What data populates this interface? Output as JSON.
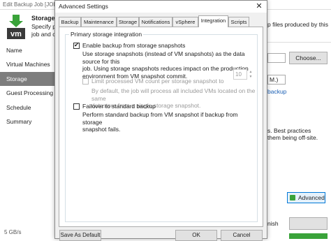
{
  "background": {
    "title": "Edit Backup Job [JOB",
    "header": {
      "title": "Storage",
      "subtitle_line1": "Specify p",
      "subtitle_line2": "job and c",
      "right_fragment": "p files produced by this"
    },
    "sidebar": {
      "items": [
        {
          "label": "Name"
        },
        {
          "label": "Virtual Machines"
        },
        {
          "label": "Storage",
          "active": true
        },
        {
          "label": "Guest Processing"
        },
        {
          "label": "Schedule"
        },
        {
          "label": "Summary"
        }
      ],
      "bottom_text": "5 GB/s"
    },
    "choose_button": "Choose...",
    "select_fragment": "M.)",
    "link_fragment": "backup",
    "note_line1": "s. Best practices",
    "note_line2": "them being off-site.",
    "advanced_button": "Advanced",
    "finish_fragment": "nish"
  },
  "dialog": {
    "title": "Advanced Settings",
    "tabs": [
      {
        "label": "Backup"
      },
      {
        "label": "Maintenance"
      },
      {
        "label": "Storage"
      },
      {
        "label": "Notifications"
      },
      {
        "label": "vSphere"
      },
      {
        "label": "Integration",
        "active": true
      },
      {
        "label": "Scripts"
      }
    ],
    "group_title": "Primary storage integration",
    "options": {
      "enable_backup": {
        "label": "Enable backup from storage snapshots",
        "checked": true,
        "description": [
          "Use storage snapshots (instead of VM snapshots) as the data source for this",
          "job. Using storage snapshots reduces impact on the production",
          "environment from VM snapshot commit."
        ]
      },
      "limit_vm_count": {
        "label": "Limit processed VM count per storage snapshot to",
        "checked": false,
        "disabled": true,
        "value": "10",
        "description": [
          "By default, the job will process all included VMs located on the same",
          "datastore from a single storage snapshot."
        ]
      },
      "failover": {
        "label": "Failover to standard backup",
        "checked": false,
        "description": [
          "Perform standard backup from VM snapshot if backup from storage",
          "snapshot fails."
        ]
      }
    },
    "buttons": {
      "save_default": "Save As Default",
      "ok": "OK",
      "cancel": "Cancel"
    }
  }
}
